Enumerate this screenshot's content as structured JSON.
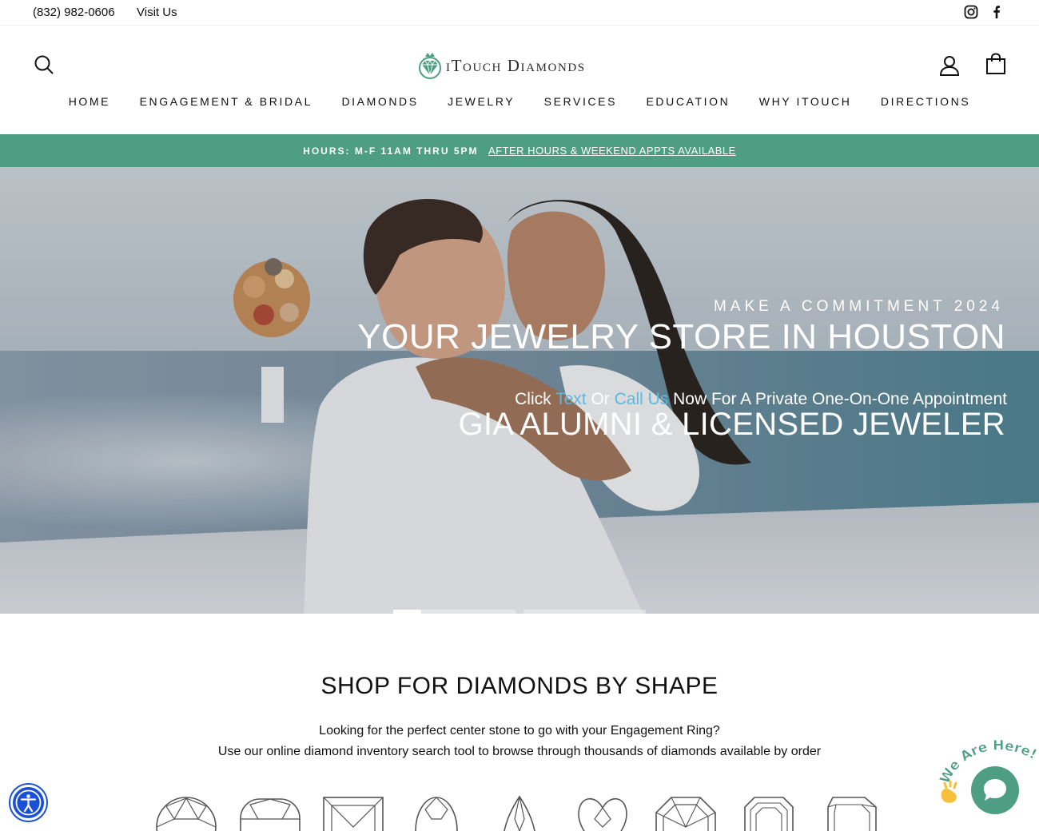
{
  "utility": {
    "phone": "(832) 982-0606",
    "visit": "Visit Us",
    "social_icons": [
      "instagram-icon",
      "facebook-icon"
    ]
  },
  "header": {
    "logo_text": "iTouch Diamonds",
    "icons": [
      "search-icon",
      "account-icon",
      "cart-icon"
    ],
    "nav": [
      "HOME",
      "ENGAGEMENT & BRIDAL",
      "DIAMONDS",
      "JEWELRY",
      "SERVICES",
      "EDUCATION",
      "WHY ITOUCH",
      "DIRECTIONS"
    ]
  },
  "hours_bar": {
    "hours": "HOURS: M-F 11AM THRU 5PM",
    "link": "AFTER HOURS & WEEKEND APPTS AVAILABLE",
    "background": "#4d9e83"
  },
  "hero": {
    "eyebrow": "MAKE A COMMITMENT 2024",
    "title": "YOUR JEWELRY STORE IN HOUSTON",
    "sub_pre": "Click ",
    "sub_text_link": "Text",
    "sub_mid": " Or ",
    "sub_call_link": "Call Us",
    "sub_post": " Now For A Private One-On-One Appointment",
    "title2": "GIA ALUMNI & LICENSED JEWELER",
    "link_color": "#5db9e0",
    "slides_count": 3,
    "active_slide": 1
  },
  "shop": {
    "title": "SHOP FOR DIAMONDS BY SHAPE",
    "desc_line1": "Looking for the perfect center stone to go with your Engagement Ring?",
    "desc_line2": "Use our online diamond inventory search tool to browse through thousands of diamonds available by order",
    "shapes": [
      "round-diamond-icon",
      "cushion-diamond-icon",
      "princess-diamond-icon",
      "oval-diamond-icon",
      "pear-diamond-icon",
      "heart-diamond-icon",
      "asscher-diamond-icon",
      "emerald-diamond-icon",
      "radiant-diamond-icon"
    ]
  },
  "widgets": {
    "chat_tag": "We Are Here!",
    "accessibility_icon": "accessibility-icon",
    "chat_icon": "chat-bubble-icon"
  }
}
